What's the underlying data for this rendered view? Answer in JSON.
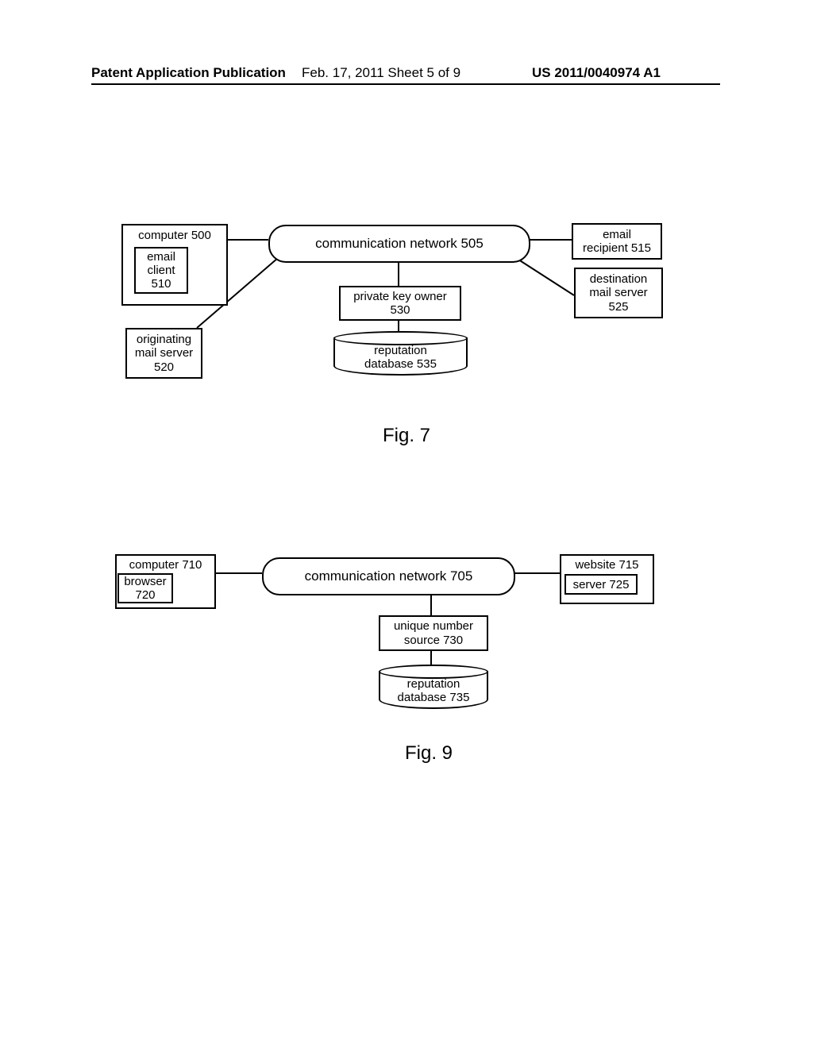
{
  "header": {
    "left": "Patent Application Publication",
    "center": "Feb. 17, 2011  Sheet 5 of 9",
    "right": "US 2011/0040974 A1"
  },
  "fig7": {
    "caption": "Fig. 7",
    "computer": "computer 500",
    "email_client": "email\nclient\n510",
    "network": "communication network 505",
    "email_recipient": "email\nrecipient 515",
    "dest_mail_server": "destination\nmail server\n525",
    "originating_mail_server": "originating\nmail server\n520",
    "private_key_owner": "private key owner\n530",
    "reputation_db": "reputation\ndatabase 535"
  },
  "fig9": {
    "caption": "Fig. 9",
    "computer": "computer 710",
    "browser": "browser\n720",
    "network": "communication network 705",
    "website": "website 715",
    "server": "server 725",
    "unique_number_source": "unique number\nsource 730",
    "reputation_db": "reputation\ndatabase 735"
  }
}
